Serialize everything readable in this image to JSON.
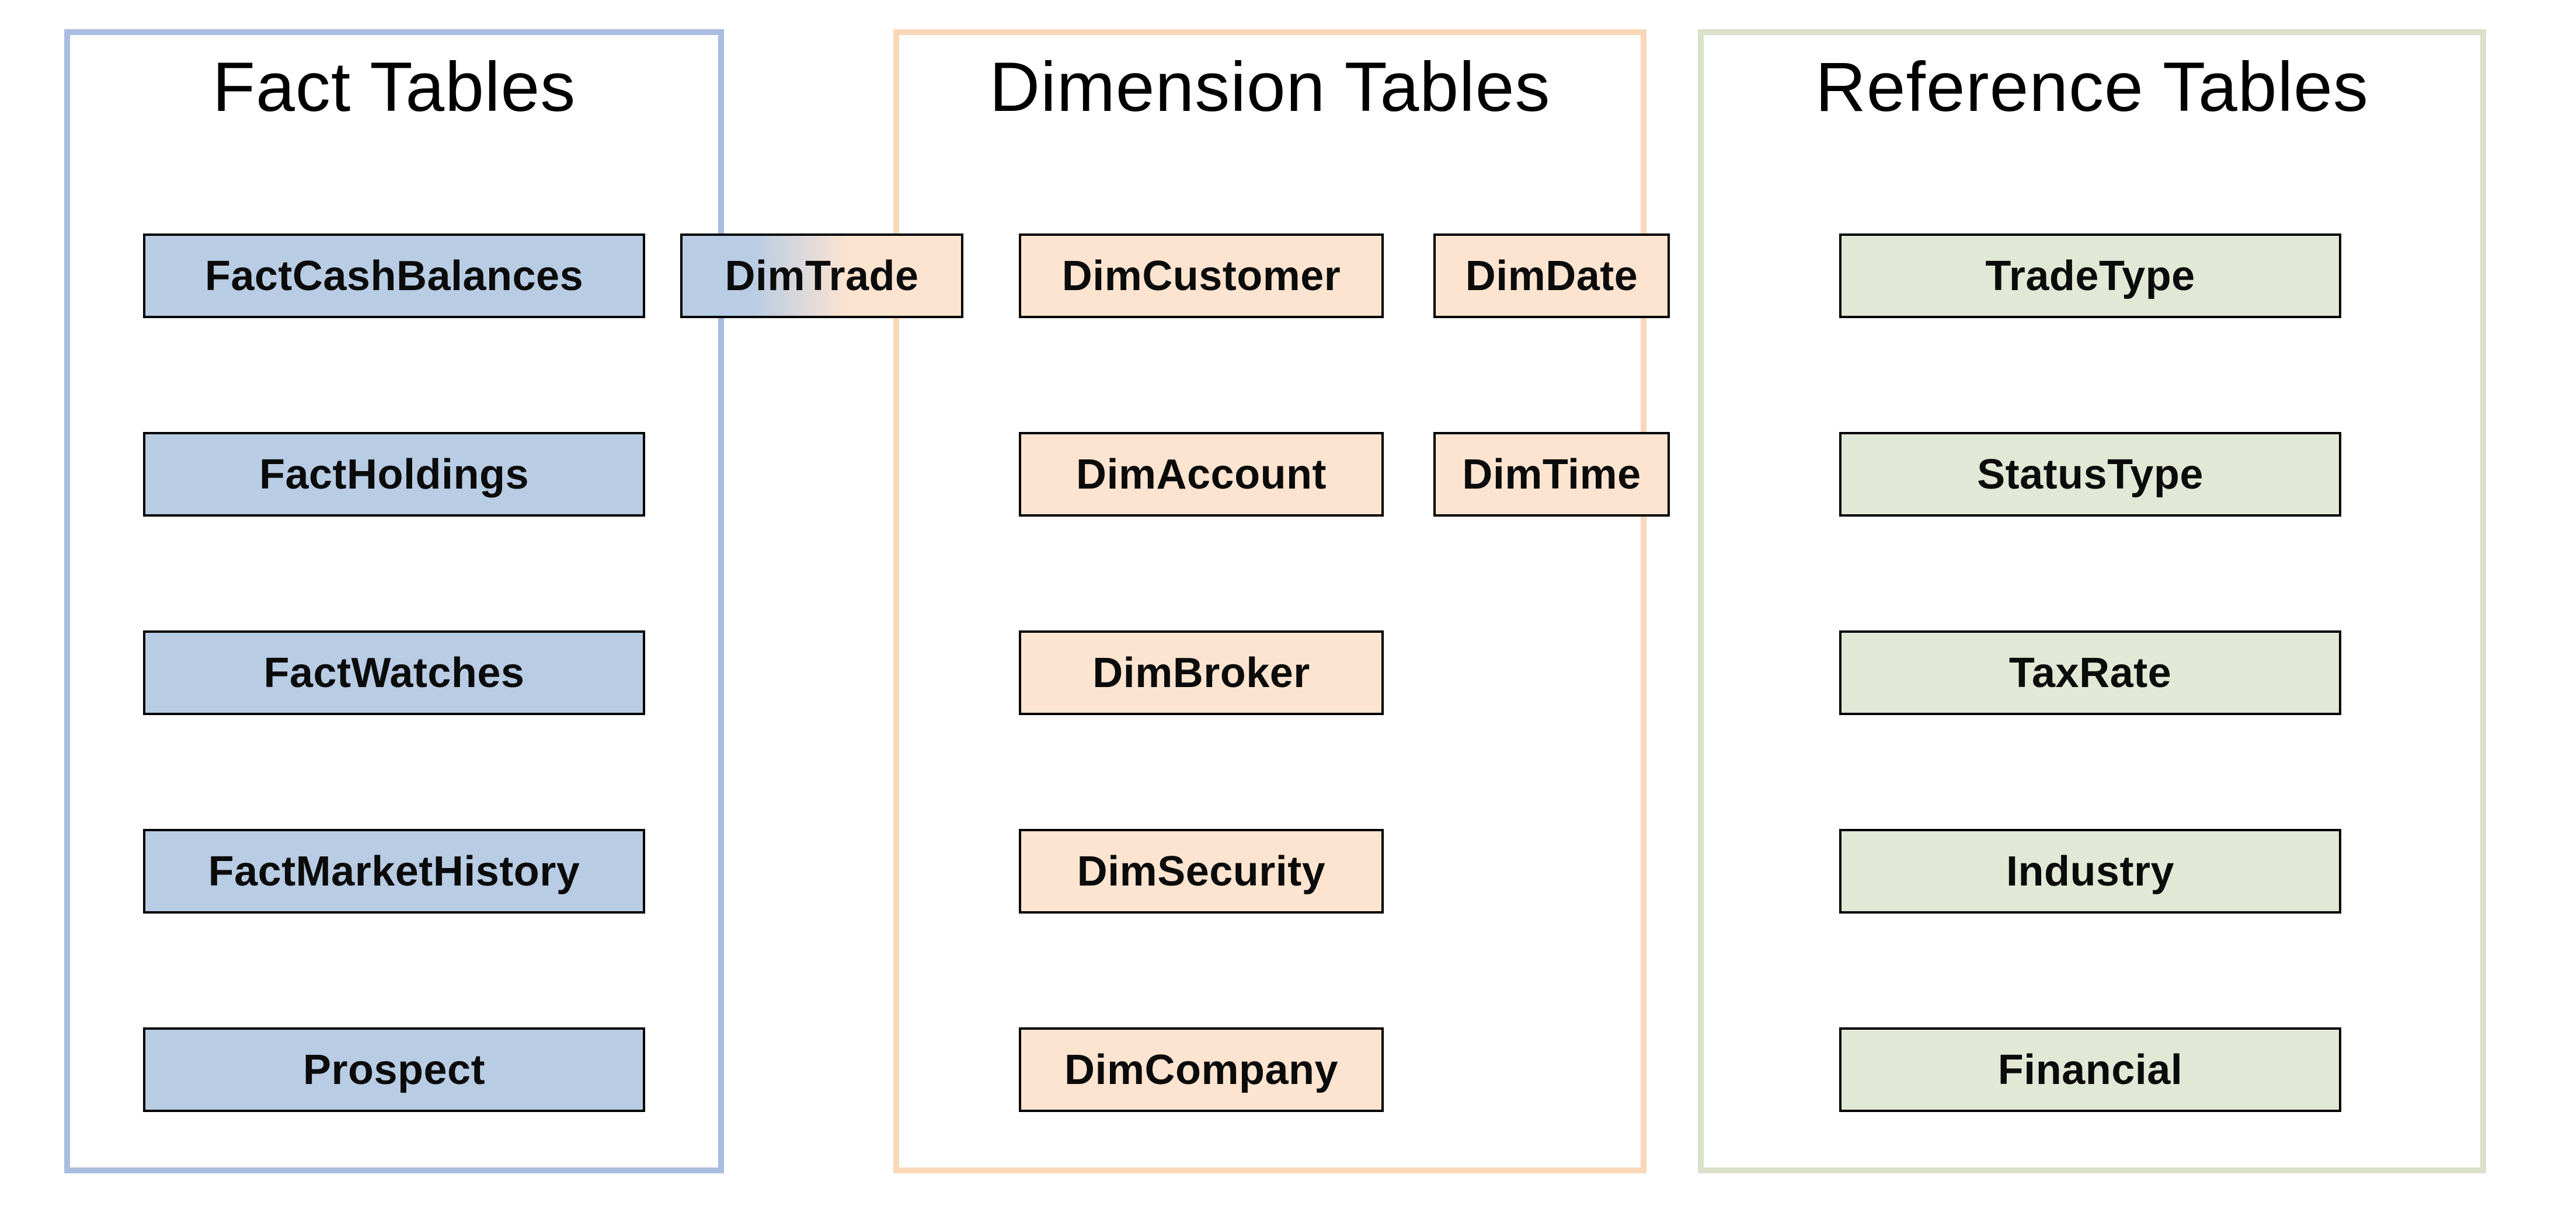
{
  "panels": {
    "fact": {
      "title": "Fact Tables",
      "border": "#a8bde0"
    },
    "dimension": {
      "title": "Dimension Tables",
      "border": "#f8d8b8"
    },
    "reference": {
      "title": "Reference Tables",
      "border": "#d9e1c9"
    }
  },
  "boxes": {
    "factCashBalances": "FactCashBalances",
    "factHoldings": "FactHoldings",
    "factWatches": "FactWatches",
    "factMarketHistory": "FactMarketHistory",
    "prospect": "Prospect",
    "dimTrade": "DimTrade",
    "dimCustomer": "DimCustomer",
    "dimAccount": "DimAccount",
    "dimBroker": "DimBroker",
    "dimSecurity": "DimSecurity",
    "dimCompany": "DimCompany",
    "dimDate": "DimDate",
    "dimTime": "DimTime",
    "tradeType": "TradeType",
    "statusType": "StatusType",
    "taxRate": "TaxRate",
    "industry": "Industry",
    "financial": "Financial"
  }
}
